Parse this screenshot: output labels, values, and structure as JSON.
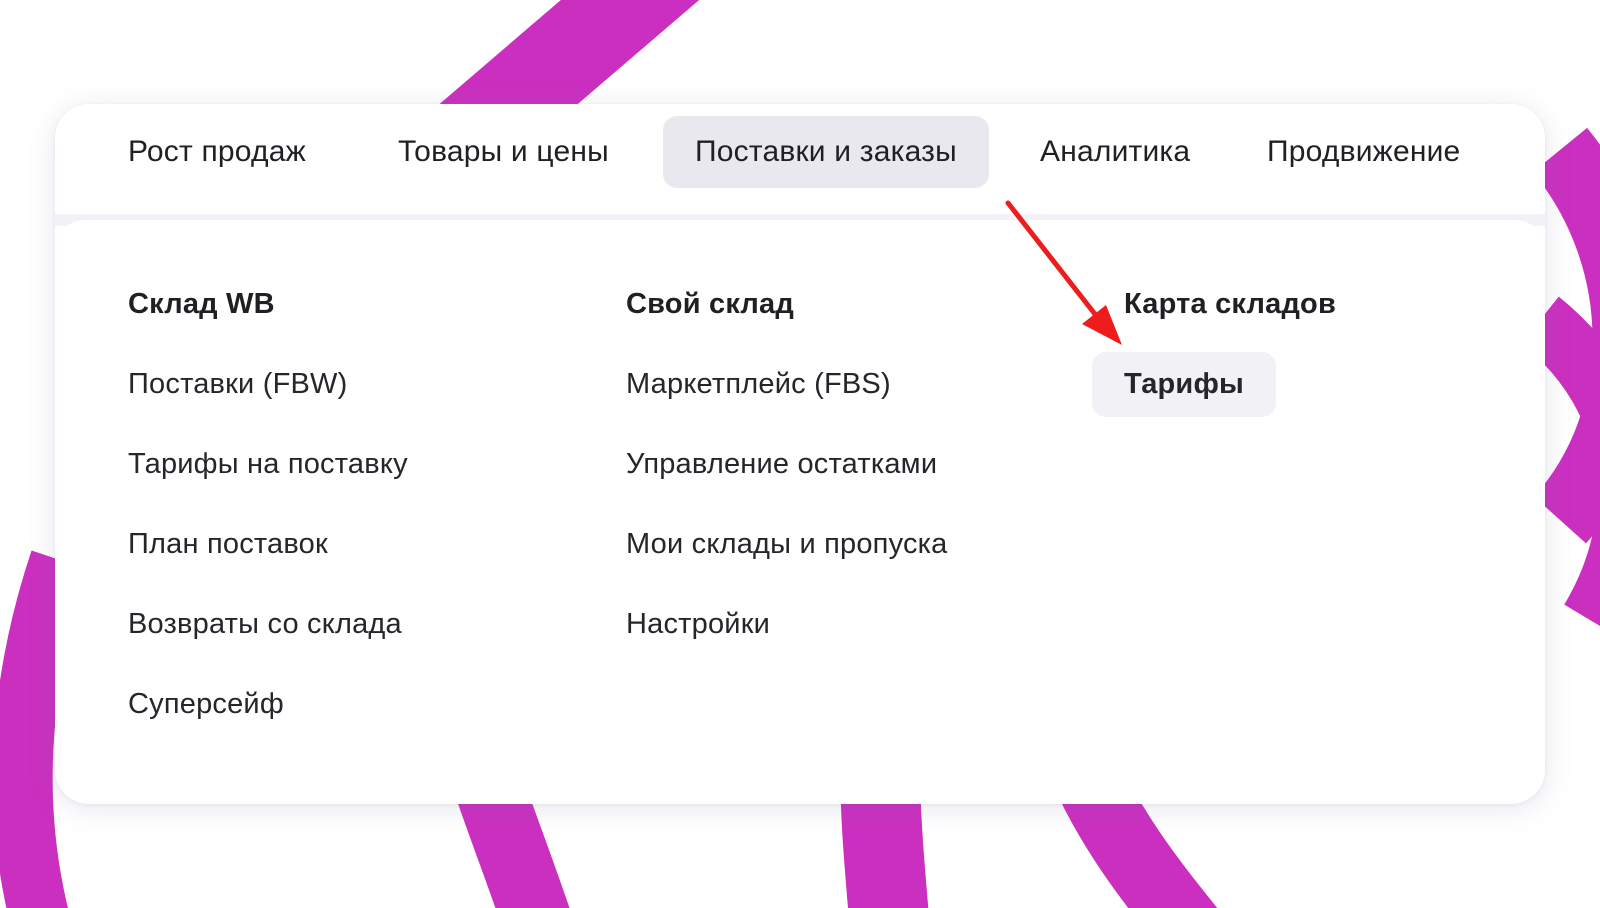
{
  "nav": {
    "items": [
      {
        "label": "Рост продаж"
      },
      {
        "label": "Товары и цены"
      },
      {
        "label": "Поставки и заказы"
      },
      {
        "label": "Аналитика"
      },
      {
        "label": "Продвижение"
      }
    ],
    "active_index": 2
  },
  "dropdown": {
    "col1": {
      "heading": "Склад WB",
      "items": [
        "Поставки (FBW)",
        "Тарифы на поставку",
        "План поставок",
        "Возвраты со склада",
        "Суперсейф"
      ]
    },
    "col2": {
      "heading": "Свой склад",
      "items": [
        "Маркетплейс (FBS)",
        "Управление остатками",
        "Мои склады и пропуска",
        "Настройки"
      ]
    },
    "col3": {
      "heading": "Карта складов",
      "items": [
        "Тарифы"
      ],
      "highlighted_item": "Тарифы"
    }
  },
  "colors": {
    "brand_stripe": "#cb2fbf",
    "annotation_arrow": "#ee1c1c",
    "active_tab_bg": "#e8e8ee",
    "hover_bg": "#f1f1f6",
    "text": "#1f1f24"
  },
  "icons": {
    "annotation": "red-arrow-icon"
  }
}
